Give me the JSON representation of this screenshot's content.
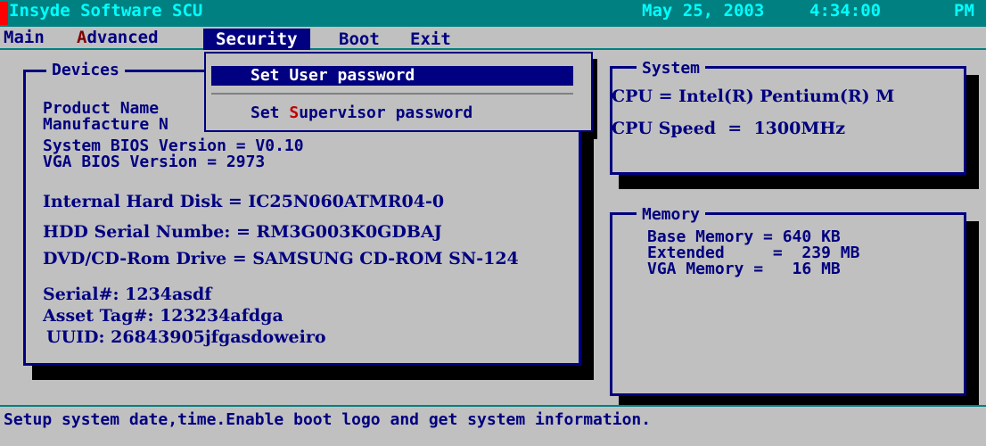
{
  "titlebar": {
    "app_name": "Insyde Software SCU",
    "date": "May 25, 2003",
    "time": "4:34:00",
    "ampm": "PM"
  },
  "menu": {
    "main": "Main",
    "advanced_hot": "A",
    "advanced_rest": "dvanced",
    "security": "Security",
    "boot": "Boot",
    "exit": "Exit"
  },
  "security_menu": {
    "items": [
      {
        "label": "Set User password",
        "selected": true
      },
      {
        "label_prefix": "Set ",
        "label_hot": "S",
        "label_rest": "upervisor password",
        "selected": false
      }
    ]
  },
  "devices": {
    "title": "Devices",
    "product_name": "Product Name",
    "manufacture": "Manufacture N",
    "system_bios": "System BIOS Version = V0.10",
    "vga_bios": "VGA BIOS Version = 2973",
    "hdd": "Internal Hard Disk = IC25N060ATMR04-0",
    "hdd_serial": "HDD Serial Numbe: = RM3G003K0GDBAJ",
    "dvd": "DVD/CD-Rom Drive = SAMSUNG CD-ROM SN-124",
    "serial": "Serial#: 1234asdf",
    "asset_tag": "Asset Tag#: 123234afdga",
    "uuid": "UUID: 26843905jfgasdoweiro"
  },
  "system": {
    "title": "System",
    "cpu": "CPU = Intel(R) Pentium(R) M",
    "cpu_speed": "CPU Speed  =  1300MHz"
  },
  "memory": {
    "title": "Memory",
    "base": "Base Memory = 640 KB",
    "extended": "Extended     =  239 MB",
    "vga": "VGA Memory =   16 MB"
  },
  "status": {
    "text": "Setup system date,time.Enable boot logo and get system information."
  },
  "colors": {
    "background": "#c0c0c0",
    "text": "#000080",
    "title_bar": "#008080",
    "title_text": "#00ffff",
    "highlight": "#000080",
    "hotkey": "#800000"
  }
}
